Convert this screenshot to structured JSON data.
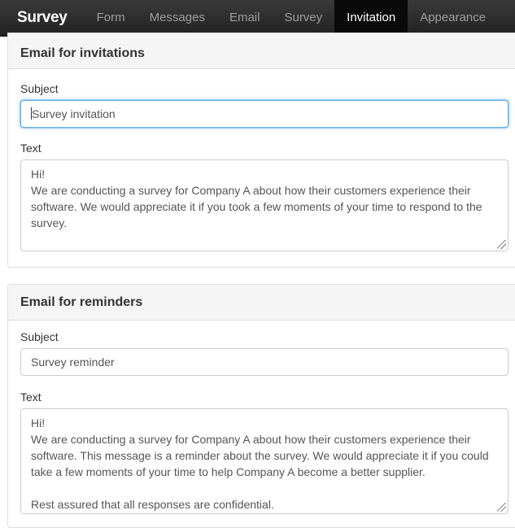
{
  "navbar": {
    "brand": "Survey",
    "items": [
      {
        "label": "Form"
      },
      {
        "label": "Messages"
      },
      {
        "label": "Email"
      },
      {
        "label": "Survey"
      },
      {
        "label": "Invitation"
      },
      {
        "label": "Appearance"
      }
    ],
    "active_item": "Invitation"
  },
  "invitation": {
    "title": "Email for invitations",
    "subject_label": "Subject",
    "subject_value": "Survey invitation",
    "text_label": "Text",
    "text_lines": [
      "Hi!",
      "We are conducting a survey for Company A about how their customers experience their",
      "software. We would appreciate it if you took a few moments of your time to respond to the",
      "survey."
    ]
  },
  "reminder": {
    "title": "Email for reminders",
    "subject_label": "Subject",
    "subject_value": "Survey reminder",
    "text_label": "Text",
    "text_lines": [
      "Hi!",
      "We are conducting a survey for Company A about how their customers experience their",
      "software. This message is a reminder about the survey. We would appreciate it if you could",
      "take a few moments of your time to help Company A become a better supplier.",
      "",
      "Rest assured that all responses are confidential."
    ]
  },
  "colors": {
    "navbar_bg": "#222222",
    "active_tab_bg": "#0a0a0a",
    "focus_ring": "#66afe9"
  }
}
